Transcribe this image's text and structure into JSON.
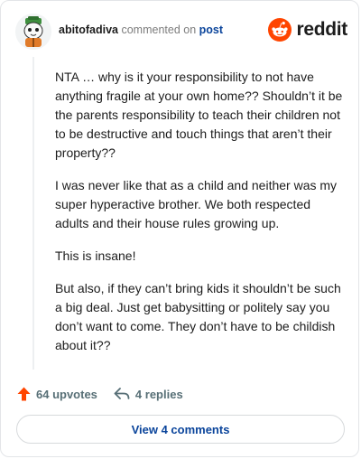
{
  "comment": {
    "username": "abitofadiva",
    "action_text": "commented on",
    "post_link": "post",
    "paragraphs": [
      "NTA … why is it your responsibility to not have anything fragile at your own home?? Shouldn’t it be the parents responsibility to teach their children not to be destructive and touch things that aren’t their property??",
      "I was never like that as a child and neither was my super hyperactive brother. We both respected adults and their house rules growing up.",
      "This is insane!",
      "But also, if they can’t bring kids it shouldn’t be such a big deal. Just get babysitting or politely say you don’t want to come. They don’t have to be childish about it??"
    ]
  },
  "brand": {
    "logo_text": "reddit",
    "logo_icon": "reddit-snoo-icon",
    "accent_color": "#ff4500"
  },
  "footer": {
    "upvotes": "64 upvotes",
    "replies": "4 replies",
    "upvote_icon": "upvote-arrow-icon",
    "reply_icon": "reply-arrow-icon",
    "upvote_color": "#ff4500"
  },
  "view_button": {
    "label": "View 4 comments"
  }
}
